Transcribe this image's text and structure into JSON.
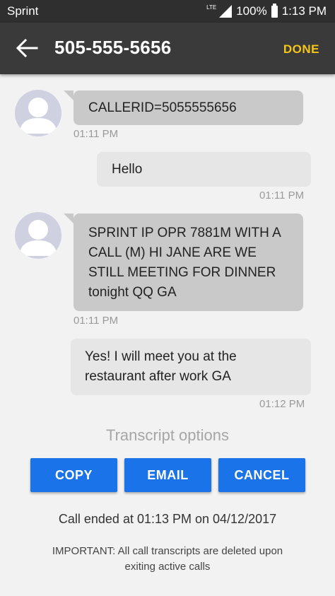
{
  "status_bar": {
    "carrier": "Sprint",
    "network": "LTE",
    "battery": "100%",
    "time": "1:13 PM"
  },
  "app_bar": {
    "title": "505-555-5656",
    "done_label": "DONE"
  },
  "messages": [
    {
      "direction": "incoming",
      "text": "CALLERID=5055555656",
      "time": "01:11 PM"
    },
    {
      "direction": "outgoing",
      "text": "Hello",
      "time": "01:11 PM"
    },
    {
      "direction": "incoming",
      "text": "SPRINT IP OPR 7881M WITH A CALL (M) HI JANE ARE WE STILL MEETING FOR DINNER tonight QQ GA",
      "time": "01:11 PM"
    },
    {
      "direction": "outgoing",
      "text": "Yes! I will meet you at the restaurant after work GA",
      "time": "01:12 PM"
    }
  ],
  "transcript_options": {
    "title": "Transcript options",
    "copy_label": "COPY",
    "email_label": "EMAIL",
    "cancel_label": "CANCEL"
  },
  "call_ended": "Call ended at 01:13 PM on 04/12/2017",
  "important_note": "IMPORTANT: All call transcripts are deleted upon exiting active calls",
  "colors": {
    "app_bar": "#3a3a3a",
    "done_accent": "#f5c518",
    "button_blue": "#1a73e8",
    "incoming_bubble": "#c9c9c9",
    "outgoing_bubble": "#e6e6e6"
  }
}
